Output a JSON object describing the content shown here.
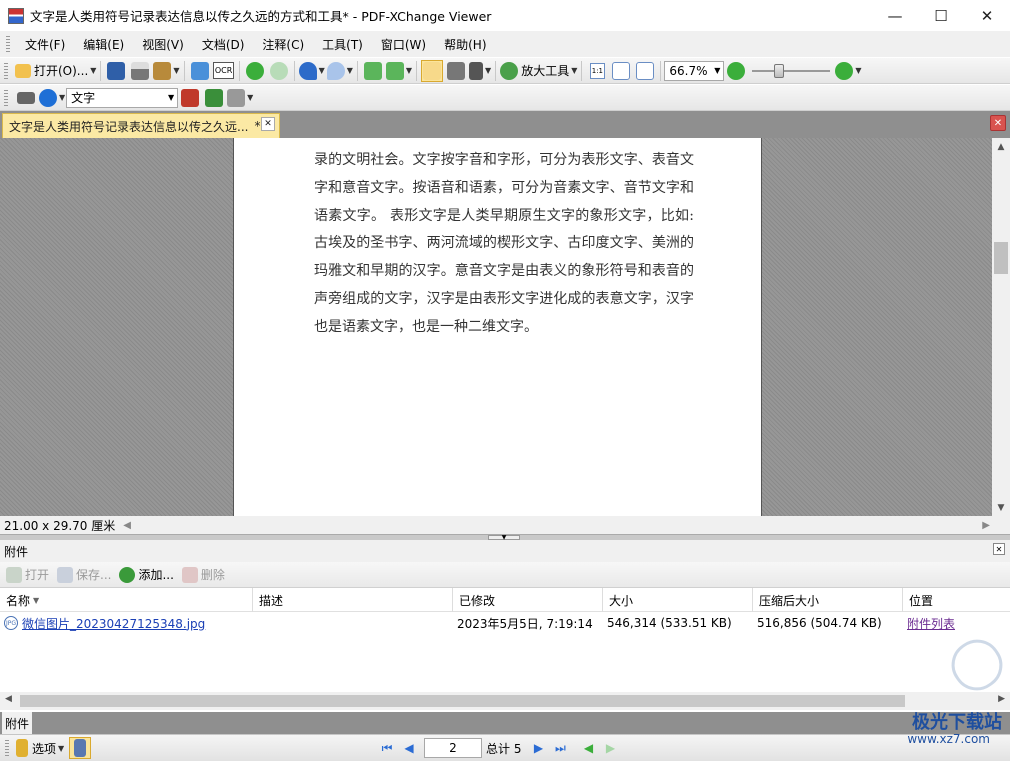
{
  "window": {
    "title": "文字是人类用符号记录表达信息以传之久远的方式和工具* - PDF-XChange Viewer",
    "minimize": "—",
    "maximize": "☐",
    "close": "✕"
  },
  "menu": [
    "文件(F)",
    "编辑(E)",
    "视图(V)",
    "文档(D)",
    "注释(C)",
    "工具(T)",
    "窗口(W)",
    "帮助(H)"
  ],
  "toolbar1": {
    "open_label": "打开(O)...",
    "zoom_tool_label": "放大工具",
    "zoom_value": "66.7%",
    "ocr_label": "OCR",
    "actual_size_label": "1:1",
    "zoom_slider_level": 0.32
  },
  "toolbar2": {
    "search_value": "文字"
  },
  "document_tab": {
    "label": "文字是人类用符号记录表达信息以传之久远...",
    "modified_marker": "*"
  },
  "page": {
    "text": "录的文明社会。文字按字音和字形，可分为表形文字、表音文字和意音文字。按语音和语素，可分为音素文字、音节文字和语素文字。 表形文字是人类早期原生文字的象形文字，比如:古埃及的圣书字、两河流域的楔形文字、古印度文字、美洲的玛雅文和早期的汉字。意音文字是由表义的象形符号和表音的声旁组成的文字，汉字是由表形文字进化成的表意文字，汉字也是语素文字，也是一种二维文字。"
  },
  "status": {
    "page_size": "21.00 x 29.70 厘米"
  },
  "attachments": {
    "panel_title": "附件",
    "tools": {
      "open": "打开",
      "save": "保存...",
      "add": "添加...",
      "delete": "删除"
    },
    "columns": [
      "名称",
      "描述",
      "已修改",
      "大小",
      "压缩后大小",
      "位置"
    ],
    "rows": [
      {
        "name": "微信图片_20230427125348.jpg",
        "description": "",
        "modified": "2023年5月5日, 7:19:14",
        "size": "546,314 (533.51 KB)",
        "compressed": "516,856 (504.74 KB)",
        "location": "附件列表"
      }
    ],
    "tab_label": "附件"
  },
  "bottom": {
    "options_label": "选项",
    "current_page": "2",
    "total_pages": "总计 5"
  },
  "watermark": {
    "line1": "极光下载站",
    "line2": "www.xz7.com"
  }
}
